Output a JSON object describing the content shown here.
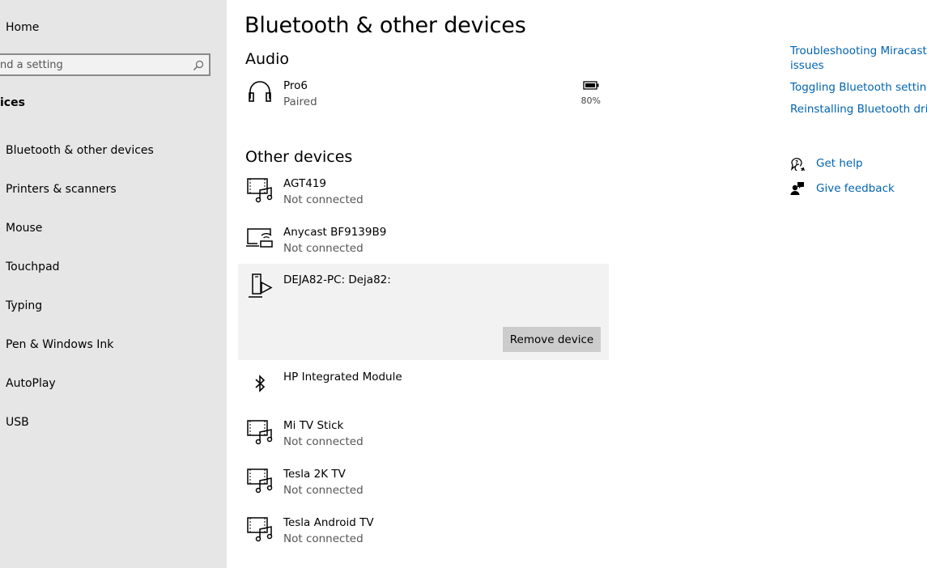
{
  "sidebar": {
    "home_label": "Home",
    "search_placeholder": "nd a setting",
    "section_label": "ices",
    "items": [
      {
        "label": "Bluetooth & other devices"
      },
      {
        "label": "Printers & scanners"
      },
      {
        "label": "Mouse"
      },
      {
        "label": "Touchpad"
      },
      {
        "label": "Typing"
      },
      {
        "label": "Pen & Windows Ink"
      },
      {
        "label": "AutoPlay"
      },
      {
        "label": "USB"
      }
    ]
  },
  "main": {
    "title": "Bluetooth & other devices",
    "audio": {
      "title": "Audio",
      "devices": [
        {
          "name": "Pro6",
          "status": "Paired",
          "battery": "80%",
          "icon": "headphones-icon"
        }
      ]
    },
    "other": {
      "title": "Other devices",
      "devices": [
        {
          "name": "AGT419",
          "status": "Not connected",
          "icon": "media-device-icon"
        },
        {
          "name": "Anycast BF9139B9",
          "status": "Not connected",
          "icon": "wireless-display-icon"
        },
        {
          "name": "DEJA82-PC: Deja82:",
          "status": "",
          "icon": "phone-play-icon",
          "selected": true,
          "action_label": "Remove device"
        },
        {
          "name": "HP Integrated Module",
          "status": "",
          "icon": "bluetooth-icon"
        },
        {
          "name": "Mi TV Stick",
          "status": "Not connected",
          "icon": "media-device-icon"
        },
        {
          "name": "Tesla 2K TV",
          "status": "Not connected",
          "icon": "media-device-icon"
        },
        {
          "name": "Tesla Android TV",
          "status": "Not connected",
          "icon": "media-device-icon"
        }
      ]
    }
  },
  "related": {
    "links": [
      {
        "label": "Troubleshooting Miracast co"
      },
      {
        "label": "issues"
      },
      {
        "label": "Toggling Bluetooth settings"
      },
      {
        "label": "Reinstalling Bluetooth drive"
      }
    ],
    "help": [
      {
        "label": "Get help",
        "icon": "get-help-icon"
      },
      {
        "label": "Give feedback",
        "icon": "feedback-icon"
      }
    ]
  },
  "colors": {
    "accent": "#0063b1",
    "sidebar_bg": "#e6e6e6",
    "selected_bg": "#f2f2f2",
    "button_bg": "#cccccc"
  }
}
